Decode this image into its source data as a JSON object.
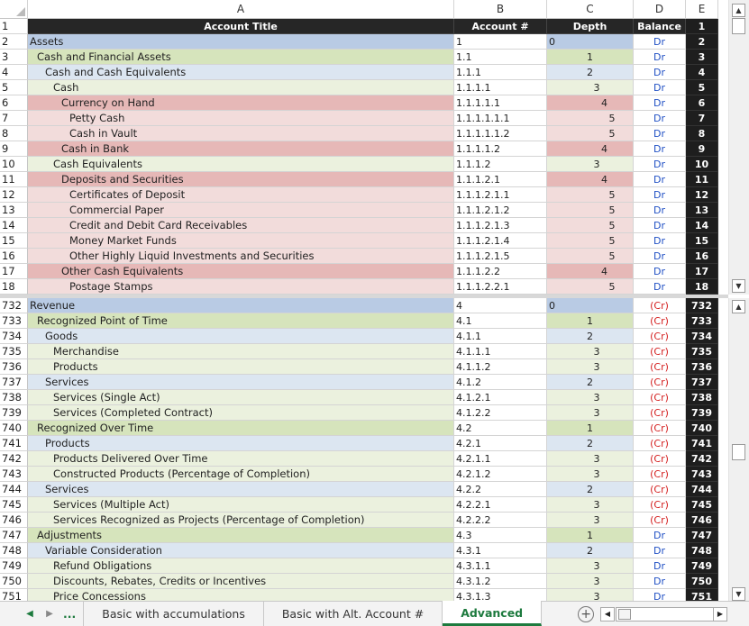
{
  "columns": [
    "A",
    "B",
    "C",
    "D",
    "E"
  ],
  "headers": {
    "title": "Account Title",
    "account": "Account #",
    "depth": "Depth",
    "balance": "Balance",
    "e": "1",
    "rownum": "1"
  },
  "top_rows": [
    {
      "n": "2",
      "title": "Assets",
      "acct": "1",
      "depth": "0",
      "bal": "Dr",
      "e": "2",
      "lvl": 0
    },
    {
      "n": "3",
      "title": "Cash and Financial Assets",
      "acct": "1.1",
      "depth": "1",
      "bal": "Dr",
      "e": "3",
      "lvl": 1
    },
    {
      "n": "4",
      "title": "Cash and Cash Equivalents",
      "acct": "1.1.1",
      "depth": "2",
      "bal": "Dr",
      "e": "4",
      "lvl": 2
    },
    {
      "n": "5",
      "title": "Cash",
      "acct": "1.1.1.1",
      "depth": "3",
      "bal": "Dr",
      "e": "5",
      "lvl": 3
    },
    {
      "n": "6",
      "title": "Currency on Hand",
      "acct": "1.1.1.1.1",
      "depth": "4",
      "bal": "Dr",
      "e": "6",
      "lvl": 4
    },
    {
      "n": "7",
      "title": "Petty Cash",
      "acct": "1.1.1.1.1.1",
      "depth": "5",
      "bal": "Dr",
      "e": "7",
      "lvl": 5
    },
    {
      "n": "8",
      "title": "Cash in Vault",
      "acct": "1.1.1.1.1.2",
      "depth": "5",
      "bal": "Dr",
      "e": "8",
      "lvl": 5
    },
    {
      "n": "9",
      "title": "Cash in Bank",
      "acct": "1.1.1.1.2",
      "depth": "4",
      "bal": "Dr",
      "e": "9",
      "lvl": 4
    },
    {
      "n": "10",
      "title": "Cash Equivalents",
      "acct": "1.1.1.2",
      "depth": "3",
      "bal": "Dr",
      "e": "10",
      "lvl": 3
    },
    {
      "n": "11",
      "title": "Deposits and Securities",
      "acct": "1.1.1.2.1",
      "depth": "4",
      "bal": "Dr",
      "e": "11",
      "lvl": 4
    },
    {
      "n": "12",
      "title": "Certificates of Deposit",
      "acct": "1.1.1.2.1.1",
      "depth": "5",
      "bal": "Dr",
      "e": "12",
      "lvl": 5
    },
    {
      "n": "13",
      "title": "Commercial Paper",
      "acct": "1.1.1.2.1.2",
      "depth": "5",
      "bal": "Dr",
      "e": "13",
      "lvl": 5
    },
    {
      "n": "14",
      "title": "Credit and Debit Card Receivables",
      "acct": "1.1.1.2.1.3",
      "depth": "5",
      "bal": "Dr",
      "e": "14",
      "lvl": 5
    },
    {
      "n": "15",
      "title": "Money Market Funds",
      "acct": "1.1.1.2.1.4",
      "depth": "5",
      "bal": "Dr",
      "e": "15",
      "lvl": 5
    },
    {
      "n": "16",
      "title": "Other Highly Liquid Investments and Securities",
      "acct": "1.1.1.2.1.5",
      "depth": "5",
      "bal": "Dr",
      "e": "16",
      "lvl": 5
    },
    {
      "n": "17",
      "title": "Other Cash Equivalents",
      "acct": "1.1.1.2.2",
      "depth": "4",
      "bal": "Dr",
      "e": "17",
      "lvl": 4
    },
    {
      "n": "18",
      "title": "Postage Stamps",
      "acct": "1.1.1.2.2.1",
      "depth": "5",
      "bal": "Dr",
      "e": "18",
      "lvl": 5
    }
  ],
  "bottom_rows": [
    {
      "n": "732",
      "title": "Revenue",
      "acct": "4",
      "depth": "0",
      "bal": "(Cr)",
      "e": "732",
      "lvl": 0
    },
    {
      "n": "733",
      "title": "Recognized Point of Time",
      "acct": "4.1",
      "depth": "1",
      "bal": "(Cr)",
      "e": "733",
      "lvl": 1
    },
    {
      "n": "734",
      "title": "Goods",
      "acct": "4.1.1",
      "depth": "2",
      "bal": "(Cr)",
      "e": "734",
      "lvl": 2
    },
    {
      "n": "735",
      "title": "Merchandise",
      "acct": "4.1.1.1",
      "depth": "3",
      "bal": "(Cr)",
      "e": "735",
      "lvl": 3
    },
    {
      "n": "736",
      "title": "Products",
      "acct": "4.1.1.2",
      "depth": "3",
      "bal": "(Cr)",
      "e": "736",
      "lvl": 3
    },
    {
      "n": "737",
      "title": "Services",
      "acct": "4.1.2",
      "depth": "2",
      "bal": "(Cr)",
      "e": "737",
      "lvl": 2
    },
    {
      "n": "738",
      "title": "Services (Single Act)",
      "acct": "4.1.2.1",
      "depth": "3",
      "bal": "(Cr)",
      "e": "738",
      "lvl": 3
    },
    {
      "n": "739",
      "title": "Services (Completed Contract)",
      "acct": "4.1.2.2",
      "depth": "3",
      "bal": "(Cr)",
      "e": "739",
      "lvl": 3
    },
    {
      "n": "740",
      "title": "Recognized Over Time",
      "acct": "4.2",
      "depth": "1",
      "bal": "(Cr)",
      "e": "740",
      "lvl": 1
    },
    {
      "n": "741",
      "title": "Products",
      "acct": "4.2.1",
      "depth": "2",
      "bal": "(Cr)",
      "e": "741",
      "lvl": 2
    },
    {
      "n": "742",
      "title": "Products Delivered Over Time",
      "acct": "4.2.1.1",
      "depth": "3",
      "bal": "(Cr)",
      "e": "742",
      "lvl": 3
    },
    {
      "n": "743",
      "title": "Constructed Products (Percentage of Completion)",
      "acct": "4.2.1.2",
      "depth": "3",
      "bal": "(Cr)",
      "e": "743",
      "lvl": 3
    },
    {
      "n": "744",
      "title": "Services",
      "acct": "4.2.2",
      "depth": "2",
      "bal": "(Cr)",
      "e": "744",
      "lvl": 2
    },
    {
      "n": "745",
      "title": "Services (Multiple Act)",
      "acct": "4.2.2.1",
      "depth": "3",
      "bal": "(Cr)",
      "e": "745",
      "lvl": 3
    },
    {
      "n": "746",
      "title": "Services Recognized as Projects (Percentage of Completion)",
      "acct": "4.2.2.2",
      "depth": "3",
      "bal": "(Cr)",
      "e": "746",
      "lvl": 3
    },
    {
      "n": "747",
      "title": "Adjustments",
      "acct": "4.3",
      "depth": "1",
      "bal": "Dr",
      "e": "747",
      "lvl": 1
    },
    {
      "n": "748",
      "title": "Variable Consideration",
      "acct": "4.3.1",
      "depth": "2",
      "bal": "Dr",
      "e": "748",
      "lvl": 2
    },
    {
      "n": "749",
      "title": "Refund Obligations",
      "acct": "4.3.1.1",
      "depth": "3",
      "bal": "Dr",
      "e": "749",
      "lvl": 3
    },
    {
      "n": "750",
      "title": "Discounts, Rebates, Credits or Incentives",
      "acct": "4.3.1.2",
      "depth": "3",
      "bal": "Dr",
      "e": "750",
      "lvl": 3
    },
    {
      "n": "751",
      "title": "Price Concessions",
      "acct": "4.3.1.3",
      "depth": "3",
      "bal": "Dr",
      "e": "751",
      "lvl": 3
    }
  ],
  "tabs": {
    "more": "...",
    "items": [
      "Basic with accumulations",
      "Basic with Alt. Account #",
      "Advanced"
    ],
    "active": "Advanced",
    "add": "+"
  },
  "colors": {
    "dark_header": "#262626",
    "debit": "#1f4fc4",
    "credit": "#d41e1e",
    "active_tab": "#1d7a3e"
  }
}
